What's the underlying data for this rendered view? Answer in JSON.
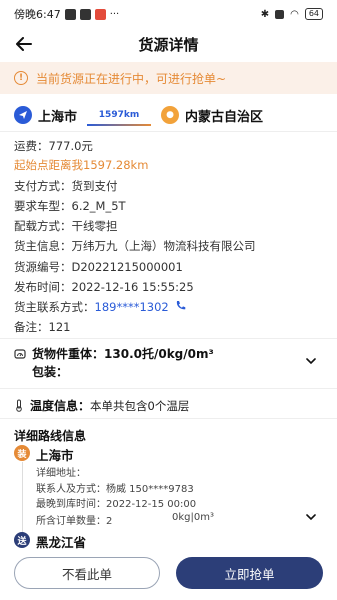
{
  "status_bar": {
    "time": "傍晚6:47",
    "battery": "64"
  },
  "header": {
    "title": "货源详情"
  },
  "notice": {
    "text": "当前货源正在进行中，可进行抢单~"
  },
  "route": {
    "from": "上海市",
    "distance": "1597km",
    "to": "内蒙古自治区"
  },
  "details": {
    "freight": {
      "label": "运费：",
      "value": "777.0元"
    },
    "distance_from_me": "起始点距离我1597.28km",
    "payment": {
      "label": "支付方式：",
      "value": "货到支付"
    },
    "vehicle": {
      "label": "要求车型：",
      "value": "6.2_M_5T"
    },
    "delivery": {
      "label": "配载方式：",
      "value": "干线零担"
    },
    "shipper": {
      "label": "货主信息：",
      "value": "万纬万九（上海）物流科技有限公司"
    },
    "source_no": {
      "label": "货源编号：",
      "value": "D20221215000001"
    },
    "publish_time": {
      "label": "发布时间：",
      "value": "2022-12-16 15:55:25"
    },
    "contact": {
      "label": "货主联系方式：",
      "value": "189****1302"
    },
    "remark": {
      "label": "备注：",
      "value": "121"
    }
  },
  "cargo": {
    "weight_label": "货物件重体：",
    "weight_value": "130.0托/0kg/0m³",
    "package_label": "包装："
  },
  "temperature": {
    "label": "温度信息：",
    "value": "本单共包含0个温层"
  },
  "route_detail": {
    "title": "详细路线信息",
    "stops": [
      {
        "badge": "装",
        "city": "上海市",
        "address_label": "详细地址：",
        "contact": "联系人及方式：杨威 150****9783",
        "latest_time": "最晚到库时间：2022-12-15 00:00",
        "order_qty": "所含订单数量：2",
        "order_size": "0kg|0m³"
      },
      {
        "badge": "送",
        "city": "黑龙江省"
      }
    ]
  },
  "actions": {
    "reject": "不看此单",
    "grab": "立即抢单"
  },
  "colors": {
    "primary": "#2c3e78",
    "accent": "#e58a36",
    "blue": "#2a5bd7"
  }
}
